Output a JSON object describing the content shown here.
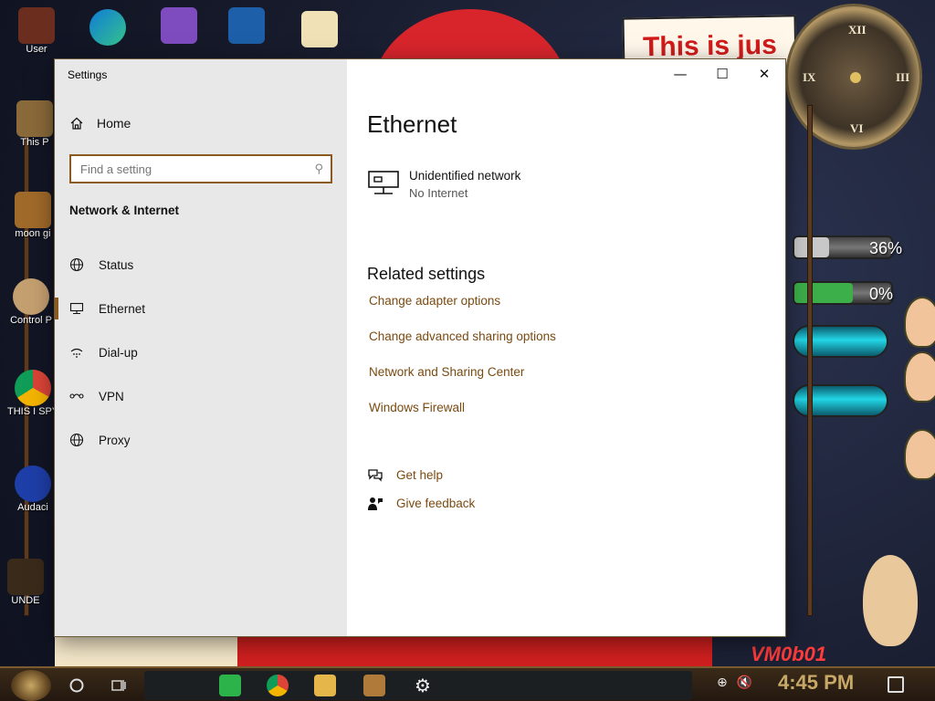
{
  "window": {
    "title": "Settings",
    "controls": {
      "minimize": "—",
      "maximize": "☐",
      "close": "✕"
    }
  },
  "nav": {
    "home": "Home",
    "search": {
      "placeholder": "Find a setting"
    },
    "section": "Network & Internet",
    "items": [
      {
        "label": "Status",
        "icon": "globe-icon"
      },
      {
        "label": "Ethernet",
        "icon": "ethernet-icon",
        "selected": true
      },
      {
        "label": "Dial-up",
        "icon": "dialup-icon"
      },
      {
        "label": "VPN",
        "icon": "vpn-icon"
      },
      {
        "label": "Proxy",
        "icon": "globe-icon"
      }
    ]
  },
  "content": {
    "title": "Ethernet",
    "network": {
      "name": "Unidentified network",
      "status": "No Internet"
    },
    "related_title": "Related settings",
    "links": [
      "Change adapter options",
      "Change advanced sharing options",
      "Network and Sharing Center",
      "Windows Firewall"
    ],
    "help": {
      "get_help": "Get help",
      "feedback": "Give feedback"
    }
  },
  "desktop": {
    "banner": "This is jus",
    "meters": [
      "36%",
      "0%"
    ],
    "vm_text": "VM0b01",
    "icons": [
      "User",
      "This P",
      "moon gi",
      "Control P",
      "THIS I SPYWA",
      "Audaci",
      "UNDE"
    ]
  },
  "taskbar": {
    "time": "4:45 PM"
  },
  "colors": {
    "accent": "#8a5a1f",
    "link": "#7a4a10",
    "nav_bg": "#e8e8e8"
  }
}
